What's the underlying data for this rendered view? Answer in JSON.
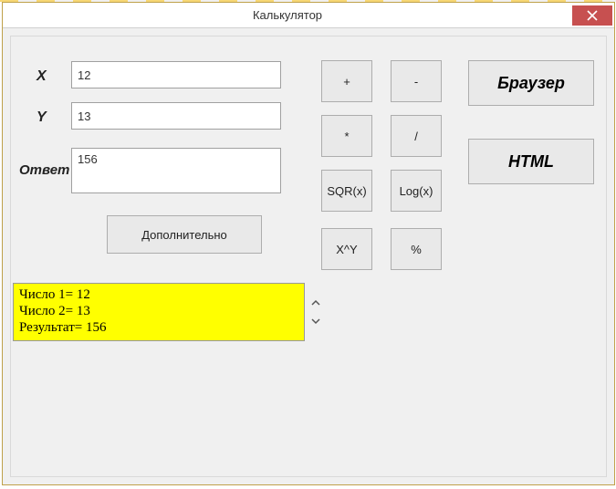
{
  "window": {
    "title": "Калькулятор",
    "close_icon": "×"
  },
  "labels": {
    "x": "X",
    "y": "Y",
    "answer": "Ответ"
  },
  "inputs": {
    "x": "12",
    "y": "13",
    "answer": "156"
  },
  "buttons": {
    "extra": "Дополнительно",
    "plus": "+",
    "minus": "-",
    "mul": "*",
    "div": "/",
    "sqr": "SQR(x)",
    "log": "Log(x)",
    "pow": "X^Y",
    "pct": "%",
    "browser": "Браузер",
    "html": "HTML"
  },
  "log": {
    "line1": "Число 1= 12",
    "line2": "Число 2= 13",
    "line3": "Результат= 156"
  }
}
